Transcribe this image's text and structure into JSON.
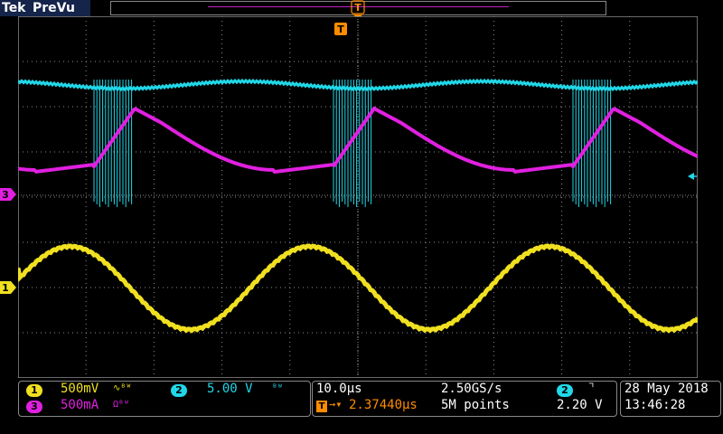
{
  "topbar": {
    "brand": "Tek",
    "mode": "PreVu"
  },
  "colors": {
    "ch1": "#f0e020",
    "ch2": "#20d8e8",
    "ch3": "#e020e0",
    "grid": "#8a8a8a",
    "trigger": "#ff8c00"
  },
  "icons": {
    "trigger": "trigger-marker-icon",
    "slope": "falling-edge-icon",
    "bandwidth": "bw-limit-icon"
  },
  "markers": {
    "ch3": "3",
    "ch1": "1",
    "trigger_top": "T",
    "trigger_screen": "T"
  },
  "channels": {
    "ch1": {
      "num": "1",
      "scale": "500mV",
      "suffix": "∿ᴮᵂ"
    },
    "ch2": {
      "num": "2",
      "scale": "5.00 V",
      "suffix": "ᴮᵂ"
    },
    "ch3": {
      "num": "3",
      "scale": "500mA",
      "suffix": "Ωᴮᵂ"
    }
  },
  "timebase": {
    "scale": "10.0µs",
    "sample_rate": "2.50GS/s",
    "delay": "2.37440µs",
    "record_length": "5M points"
  },
  "trigger": {
    "source": "2",
    "level": "2.20 V"
  },
  "datetime": {
    "date": "28 May 2018",
    "time": "13:46:28"
  }
}
